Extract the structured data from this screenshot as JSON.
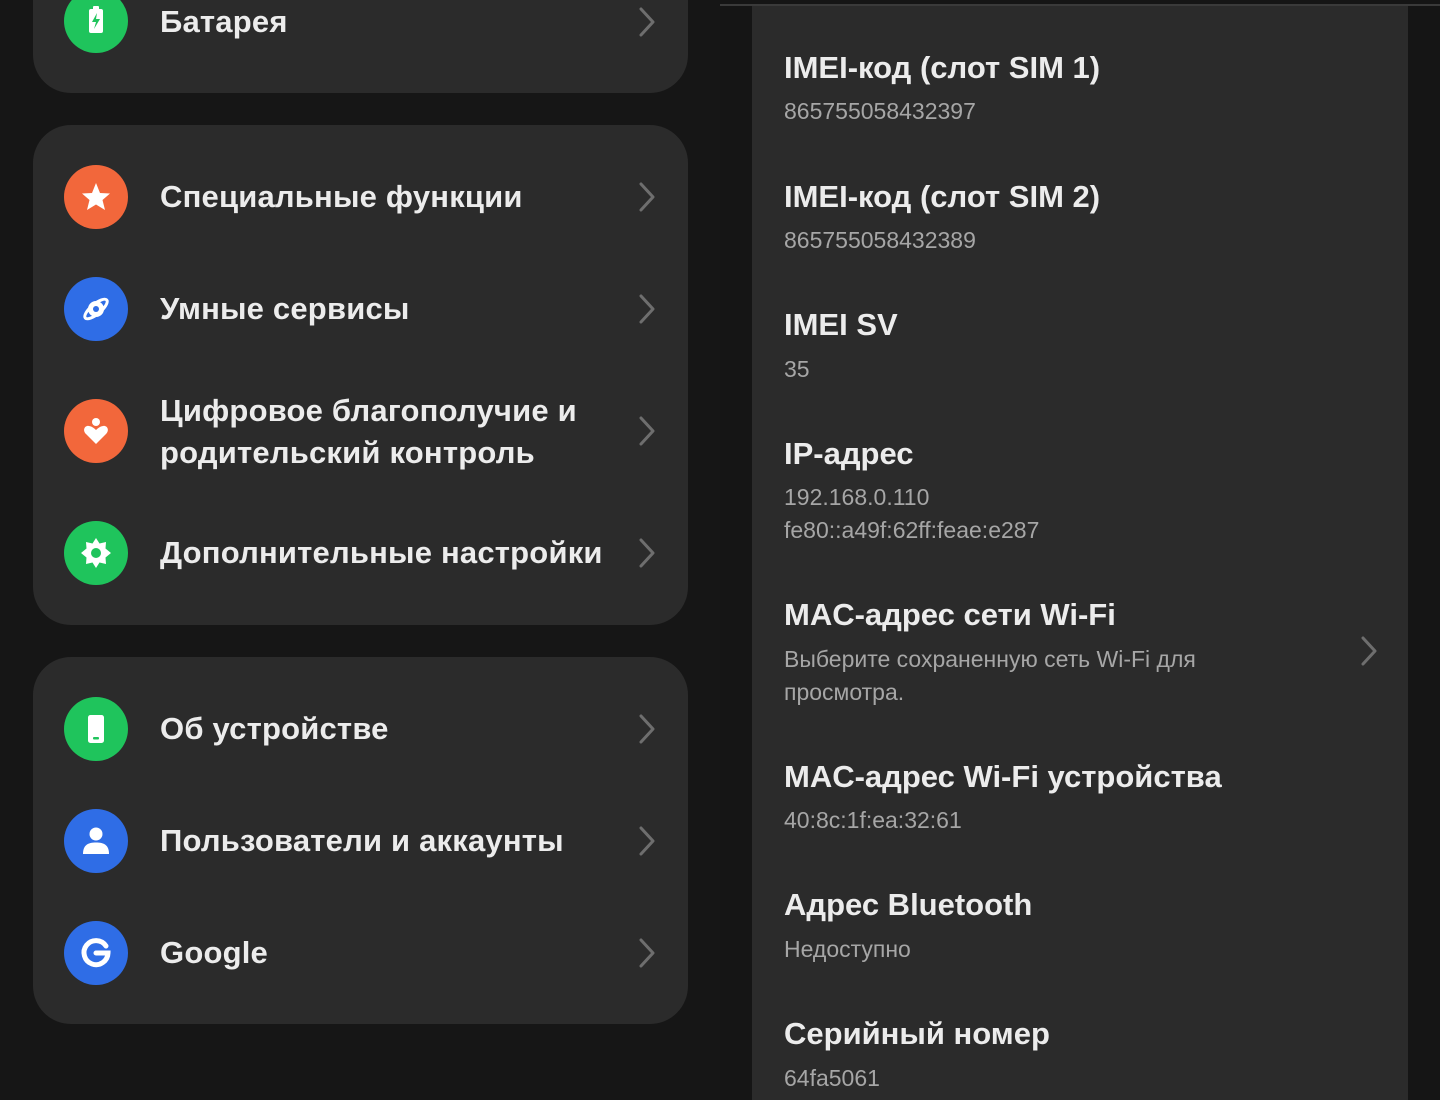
{
  "settings_menu": {
    "groups": [
      {
        "items": [
          {
            "label": "Батарея",
            "icon": "battery-icon",
            "color": "#1fc45c"
          }
        ]
      },
      {
        "items": [
          {
            "label": "Специальные функции",
            "icon": "star-icon",
            "color": "#f2673b"
          },
          {
            "label": "Умные сервисы",
            "icon": "smart-services-icon",
            "color": "#2f6de6"
          },
          {
            "label_line1": "Цифровое благополучие и",
            "label_line2": "родительский контроль",
            "icon": "heart-person-icon",
            "color": "#f2673b"
          },
          {
            "label": "Дополнительные настройки",
            "icon": "gear-icon",
            "color": "#1fc45c"
          }
        ]
      },
      {
        "items": [
          {
            "label": "Об устройстве",
            "icon": "phone-device-icon",
            "color": "#1fc45c"
          },
          {
            "label": "Пользователи и аккаунты",
            "icon": "user-icon",
            "color": "#2f6de6"
          },
          {
            "label": "Google",
            "icon": "google-icon",
            "color": "#2f6de6"
          }
        ]
      }
    ]
  },
  "device_info": {
    "items": [
      {
        "title": "IMEI-код (слот SIM 1)",
        "value": "865755058432397"
      },
      {
        "title": "IMEI-код (слот SIM 2)",
        "value": "865755058432389"
      },
      {
        "title": "IMEI SV",
        "value": "35"
      },
      {
        "title": "IP-адрес",
        "value_line1": "192.168.0.110",
        "value_line2": "fe80::a49f:62ff:feae:e287"
      },
      {
        "title": "MAC-адрес сети Wi-Fi",
        "value_line1": "Выберите сохраненную сеть Wi-Fi для",
        "value_line2": "просмотра.",
        "has_chevron": true
      },
      {
        "title": "MAC-адрес Wi-Fi устройства",
        "value": "40:8c:1f:ea:32:61"
      },
      {
        "title": "Адрес Bluetooth",
        "value": "Недоступно"
      },
      {
        "title": "Серийный номер",
        "value": "64fa5061"
      }
    ]
  },
  "colors": {
    "background": "#161616",
    "card": "#2b2b2b",
    "text_primary": "#ececec",
    "text_secondary": "#a6a6a6",
    "accent_green": "#1fc45c",
    "accent_orange": "#f2673b",
    "accent_blue": "#2f6de6"
  }
}
